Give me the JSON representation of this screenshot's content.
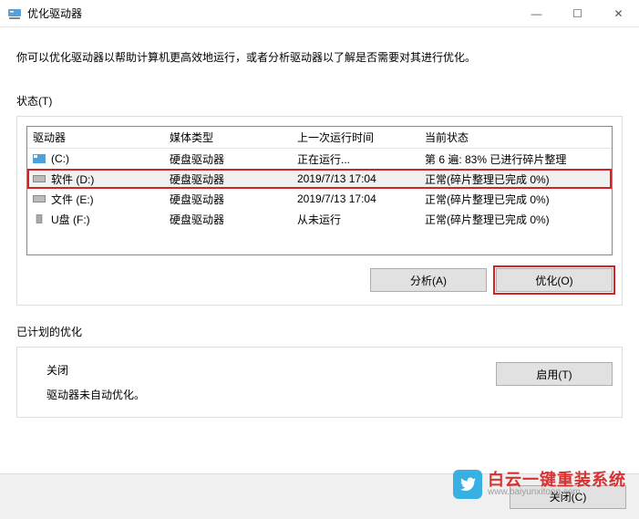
{
  "window": {
    "title": "优化驱动器",
    "minimize": "—",
    "maximize": "☐",
    "close": "✕"
  },
  "description": "你可以优化驱动器以帮助计算机更高效地运行，或者分析驱动器以了解是否需要对其进行优化。",
  "status_label": "状态(T)",
  "columns": {
    "drive": "驱动器",
    "media": "媒体类型",
    "last": "上一次运行时间",
    "current": "当前状态"
  },
  "drives": [
    {
      "icon": "os",
      "name": "(C:)",
      "media": "硬盘驱动器",
      "last": "正在运行...",
      "status": "第 6 遍: 83% 已进行碎片整理"
    },
    {
      "icon": "hdd",
      "name": "软件 (D:)",
      "media": "硬盘驱动器",
      "last": "2019/7/13 17:04",
      "status": "正常(碎片整理已完成 0%)"
    },
    {
      "icon": "hdd",
      "name": "文件 (E:)",
      "media": "硬盘驱动器",
      "last": "2019/7/13 17:04",
      "status": "正常(碎片整理已完成 0%)"
    },
    {
      "icon": "usb",
      "name": "U盘 (F:)",
      "media": "硬盘驱动器",
      "last": "从未运行",
      "status": "正常(碎片整理已完成 0%)"
    }
  ],
  "buttons": {
    "analyze": "分析(A)",
    "optimize": "优化(O)",
    "enable": "启用(T)",
    "close": "关闭(C)"
  },
  "schedule": {
    "label": "已计划的优化",
    "state": "关闭",
    "note": "驱动器未自动优化。"
  },
  "watermark": {
    "line1": "白云一键重装系统",
    "line2": "www.baiyunxitong.com"
  }
}
